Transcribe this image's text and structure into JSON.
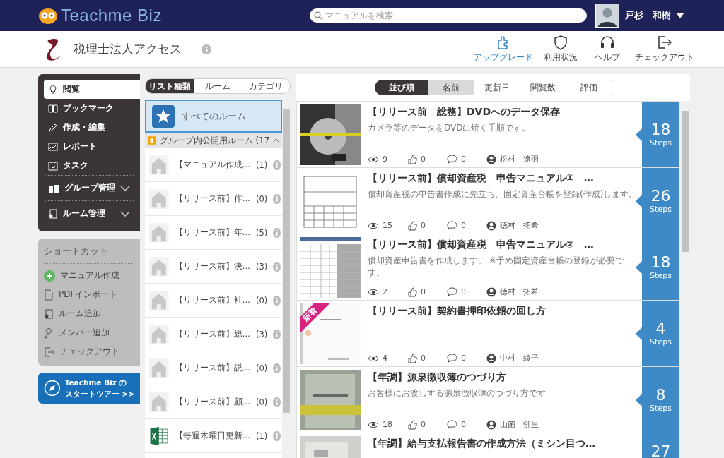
{
  "header": {
    "logo": "Teachme Biz",
    "search": {
      "placeholder": "マニュアルを検索"
    },
    "user": "戸杉　和樹"
  },
  "subheader": {
    "company": "税理士法人アクセス",
    "actions": [
      {
        "label": "アップグレード",
        "kind": "puzzle",
        "selected": true
      },
      {
        "label": "利用状況",
        "kind": "shield",
        "selected": false
      },
      {
        "label": "ヘルプ",
        "kind": "headset",
        "selected": false
      },
      {
        "label": "チェックアウト",
        "kind": "exit",
        "selected": false
      }
    ]
  },
  "nav": [
    {
      "label": "閲覧",
      "kind": "bulb",
      "selected": true
    },
    {
      "label": "ブックマーク",
      "kind": "book",
      "selected": false
    },
    {
      "label": "作成・編集",
      "kind": "pen",
      "selected": false
    },
    {
      "label": "レポート",
      "kind": "chart",
      "selected": false
    },
    {
      "label": "タスク",
      "kind": "calendar",
      "selected": false
    },
    {
      "label": "グループ管理",
      "kind": "group",
      "selected": false,
      "expanded": false
    },
    {
      "label": "ルーム管理",
      "kind": "room",
      "selected": false,
      "expanded": false
    }
  ],
  "shortcuts": {
    "title": "ショートカット",
    "items": [
      {
        "label": "マニュアル作成",
        "kind": "plus"
      },
      {
        "label": "PDFインポート",
        "kind": "pdf"
      },
      {
        "label": "ルーム追加",
        "kind": "room"
      },
      {
        "label": "メンバー追加",
        "kind": "member"
      },
      {
        "label": "チェックアウト",
        "kind": "exit"
      }
    ]
  },
  "tour": {
    "lines": [
      "Teachme Biz の",
      "スタートツアー >>"
    ]
  },
  "list_tabs": [
    {
      "label": "リスト種類",
      "selected": true
    },
    {
      "label": "ルーム",
      "selected": false
    },
    {
      "label": "カテゴリ",
      "selected": false
    }
  ],
  "all_rooms": {
    "label": "すべてのルーム",
    "selected": true
  },
  "group_header": {
    "label": "グループ内公開用ルーム (17",
    "expanded": true
  },
  "rooms": [
    {
      "name": "【マニュアル作成…",
      "count": "(1)",
      "kind": "house"
    },
    {
      "name": "【リリース前】作…",
      "count": "(0)",
      "kind": "house"
    },
    {
      "name": "【リリース前】年…",
      "count": "(5)",
      "kind": "house"
    },
    {
      "name": "【リリース前】決…",
      "count": "(3)",
      "kind": "house"
    },
    {
      "name": "【リリース前】社…",
      "count": "(0)",
      "kind": "house"
    },
    {
      "name": "【リリース前】総…",
      "count": "(3)",
      "kind": "house"
    },
    {
      "name": "【リリース前】説…",
      "count": "(0)",
      "kind": "house"
    },
    {
      "name": "【リリース前】顧…",
      "count": "(0)",
      "kind": "house"
    },
    {
      "name": "【毎週木曜日更新…",
      "count": "(1)",
      "kind": "excel"
    }
  ],
  "sort": {
    "label": "並び順",
    "options": [
      {
        "label": "名前",
        "selected": true
      },
      {
        "label": "更新日",
        "selected": false
      },
      {
        "label": "閲覧数",
        "selected": false
      },
      {
        "label": "評価",
        "selected": false
      }
    ]
  },
  "manuals": [
    {
      "title": "【リリース前　総務】DVDへのデータ保存",
      "description": "カメラ等のデータをDVDに焼く手順です。",
      "views": "9",
      "likes": "0",
      "comments": "0",
      "author": "松村　遼羽",
      "steps": "18",
      "steps_label": "Steps",
      "kind": "picture"
    },
    {
      "title": "【リリース前】償却資産税　申告マニュアル①　…",
      "description": "償却資産税の申告書作成に先立ち、固定資産台帳を登録(作成)します。",
      "views": "15",
      "likes": "0",
      "comments": "0",
      "author": "徳村　拓希",
      "steps": "26",
      "steps_label": "Steps",
      "kind": "picture"
    },
    {
      "title": "【リリース前】償却資産税　申告マニュアル②　…",
      "description": "償却資産申告書を作成します。 ※予め固定資産台帳の登録が必要です。",
      "views": "2",
      "likes": "0",
      "comments": "0",
      "author": "徳村　拓希",
      "steps": "18",
      "steps_label": "Steps",
      "kind": "picture"
    },
    {
      "title": "【リリース前】契約書押印依頼の回し方",
      "badge": "新着",
      "views": "4",
      "likes": "0",
      "comments": "0",
      "author": "中村　綾子",
      "steps": "4",
      "steps_label": "Steps",
      "kind": "picture"
    },
    {
      "title": "【年調】源泉徴収簿のつづり方",
      "description": "お客様にお渡しする源泉徴収簿のつづり方です",
      "views": "18",
      "likes": "0",
      "comments": "0",
      "author": "山菌　郁里",
      "steps": "8",
      "steps_label": "Steps",
      "kind": "picture"
    },
    {
      "title": "【年調】給与支払報告書の作成方法（ミシン目つ…",
      "steps": "27",
      "kind": "picture"
    }
  ]
}
